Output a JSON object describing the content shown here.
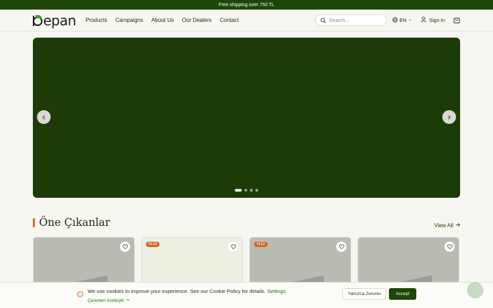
{
  "announcement": "Free shipping over 750 TL",
  "header": {
    "logo_text": "epan",
    "nav": [
      "Products",
      "Campaigns",
      "About Us",
      "Our Dealers",
      "Contact"
    ],
    "search_placeholder": "Search...",
    "language": "EN",
    "sign_in": "Sign In"
  },
  "hero": {
    "slides": 4,
    "active_slide": 1,
    "background_color": "#1d3b07"
  },
  "featured": {
    "title": "Öne Çıkanlar",
    "view_all": "View All",
    "products": [
      {
        "badge": ""
      },
      {
        "badge": "%18"
      },
      {
        "badge": "%12"
      },
      {
        "badge": ""
      }
    ]
  },
  "cookie": {
    "message": "We use cookies to improve your experience. See our Cookie Policy for details.",
    "settings_link": "Settings",
    "preferences": "Çerezleri özelleştir",
    "necessary_button": "Yalnızca Zorunlu",
    "accept_button": "Accept"
  },
  "colors": {
    "brand_green": "#1d4608",
    "accent_orange": "#d8682e",
    "logo_leaf": "#3aa037"
  }
}
